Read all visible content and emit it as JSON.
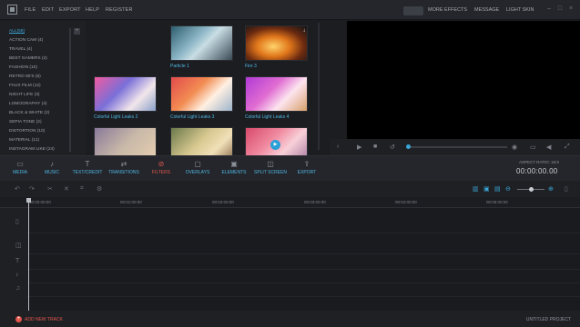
{
  "menu": [
    "FILE",
    "EDIT",
    "EXPORT",
    "HELP",
    "REGISTER"
  ],
  "top_tabs": {
    "active": "",
    "more_effects": "MORE EFFECTS",
    "message": "MESSAGE",
    "light_skin": "LIGHT SKIN"
  },
  "categories": [
    "ALL(58)",
    "ACTION CAM (4)",
    "TRAVEL (4)",
    "BEST GAMERS (2)",
    "FASHION (10)",
    "RETRO 80'S (6)",
    "FAUX FILM (12)",
    "NIGHT LIFE (3)",
    "LOMOGRAPHY (4)",
    "BLACK & WHITE (2)",
    "SEPIA TONE (2)",
    "DISTORTION (10)",
    "MATERIAL (11)",
    "INSTAGRAM LIKE (24)"
  ],
  "effects": [
    {
      "label": "Particle 1"
    },
    {
      "label": "Fire 3"
    },
    {
      "label": "Colorful Light Leaks 2"
    },
    {
      "label": "Colorful Light Leaks 3"
    },
    {
      "label": "Colorful Light Leaks 4"
    },
    {
      "label": ""
    },
    {
      "label": ""
    },
    {
      "label": ""
    }
  ],
  "toolbar": {
    "media": "MEDIA",
    "music": "MUSIC",
    "text": "TEXT/CREDIT",
    "transitions": "TRANSITIONS",
    "filters": "FILTERS",
    "overlays": "OVERLAYS",
    "elements": "ELEMENTS",
    "split": "SPLIT SCREEN",
    "export": "EXPORT"
  },
  "aspect_ratio": "ASPECT RATIO: 16:9",
  "timecode": "00:00:00.00",
  "ruler": [
    "00:00:00:00",
    "00:01:00:00",
    "00:02:00:00",
    "00:03:00:00",
    "00:04:00:00",
    "00:05:00:00"
  ],
  "add_track": "ADD NEW TRACK",
  "project": "UNTITLED PROJECT",
  "colors": {
    "accent": "#3aa6d8",
    "active_tool": "#e2574c",
    "bg": "#1c1d21"
  }
}
